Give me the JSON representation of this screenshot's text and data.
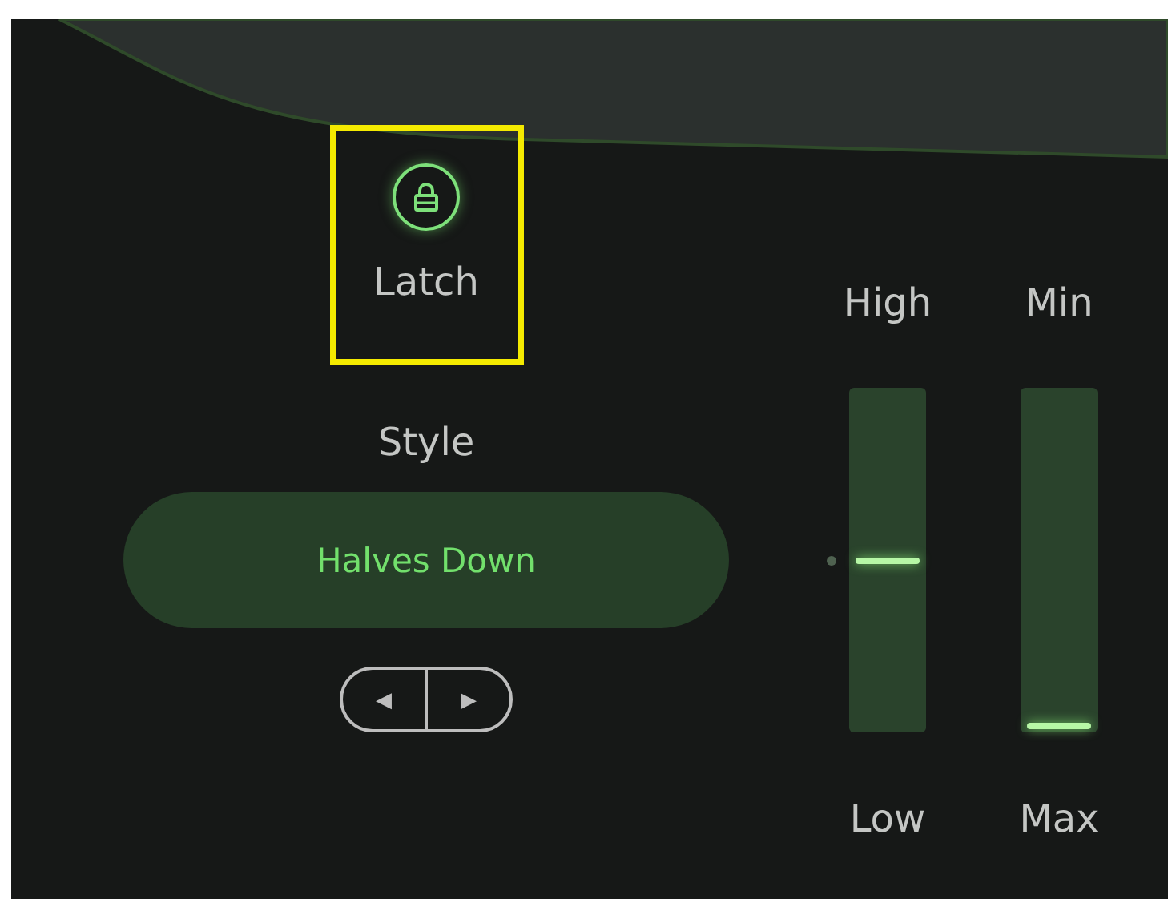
{
  "latch": {
    "label": "Latch",
    "on": true,
    "highlighted": true
  },
  "style": {
    "label": "Style",
    "value": "Halves Down",
    "prev": "◀",
    "next": "▶"
  },
  "sliders": [
    {
      "top_label": "High",
      "bottom_label": "Low",
      "level": 0.5,
      "marker": true
    },
    {
      "top_label": "Min",
      "bottom_label": "Max",
      "level": 0.02,
      "marker": false
    }
  ]
}
